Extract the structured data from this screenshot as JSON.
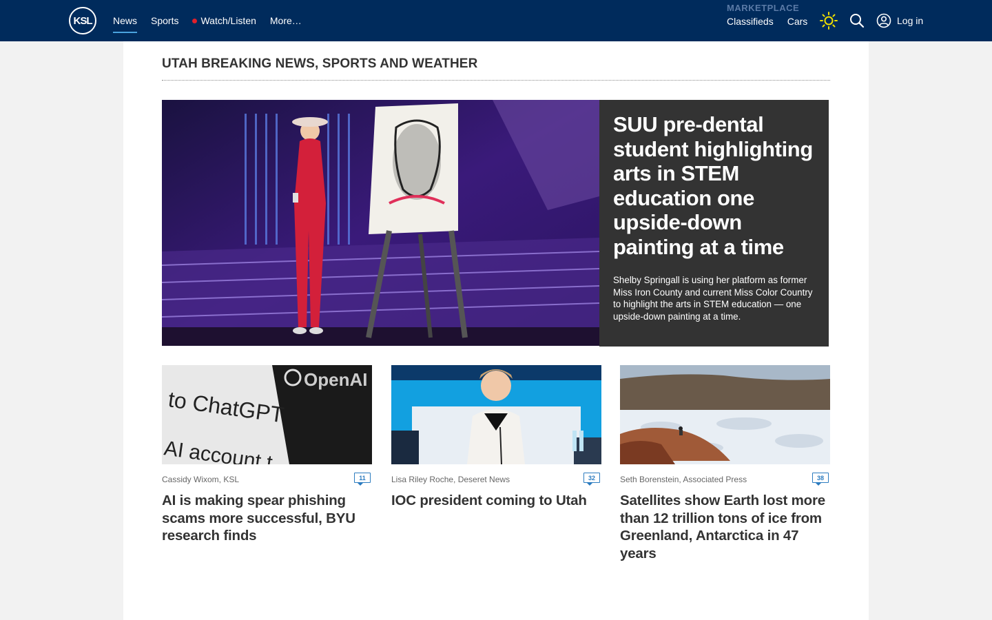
{
  "header": {
    "logo_text": "KSL",
    "nav": [
      {
        "label": "News",
        "active": true
      },
      {
        "label": "Sports"
      },
      {
        "label": "Watch/Listen",
        "live": true
      },
      {
        "label": "More…"
      }
    ],
    "marketplace": {
      "label": "MARKETPLACE",
      "links": [
        "Classifieds",
        "Cars"
      ]
    },
    "login_label": "Log in",
    "icons": [
      "ksl-logo",
      "sun-icon",
      "search-icon",
      "user-circle-icon"
    ]
  },
  "main": {
    "section_title": "UTAH BREAKING NEWS, SPORTS AND WEATHER",
    "hero": {
      "title": "SUU pre-dental student highlighting arts in STEM education one upside-down painting at a time",
      "description": "Shelby Springall is using her platform as former Miss Iron County and current Miss Color Country to highlight the arts in STEM education — one upside-down painting at a time.",
      "image": "performer-in-red-sequined-jumpsuit-beside-dolly-portrait-easel"
    },
    "cards": [
      {
        "byline": "Cassidy Wixom, KSL",
        "comments": "11",
        "title": "AI is making spear phishing scams more successful, BYU research finds",
        "image": "chatgpt-openai-screen-closeup"
      },
      {
        "byline": "Lisa Riley Roche, Deseret News",
        "comments": "32",
        "title": "IOC president coming to Utah",
        "image": "woman-at-press-conference-table"
      },
      {
        "byline": "Seth Borenstein, Associated Press",
        "comments": "38",
        "title": "Satellites show Earth lost more than 12 trillion tons of ice from Greenland, Antarctica in 47 years",
        "image": "person-on-rocks-overlooking-ice-fjord"
      }
    ]
  },
  "colors": {
    "header_bg": "#002b5c",
    "accent_blue": "#2b7bbf",
    "hero_box_bg": "#333333",
    "live_dot": "#e0202b",
    "sun_icon": "#f0e000"
  }
}
